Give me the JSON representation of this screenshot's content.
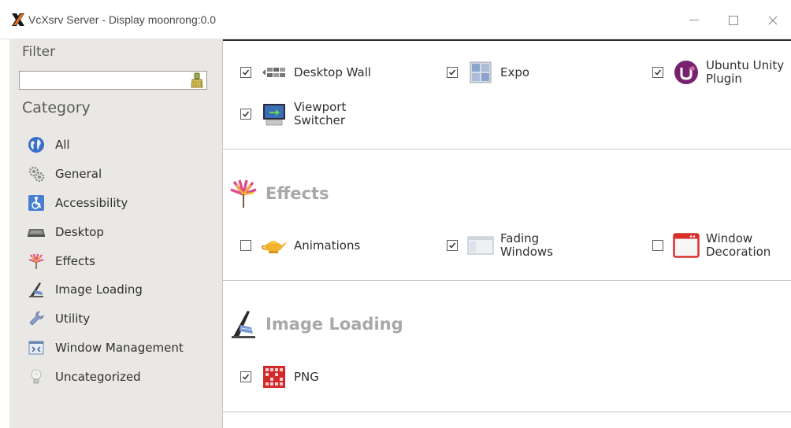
{
  "window": {
    "title": "VcXsrv Server - Display moonrong:0.0",
    "controls": {
      "minimize": "—",
      "maximize": "☐",
      "close": "✕"
    }
  },
  "sidebar": {
    "filter_title": "Filter",
    "filter_value": "",
    "category_title": "Category",
    "categories": [
      {
        "label": "All",
        "icon": "globe-icon"
      },
      {
        "label": "General",
        "icon": "gears-icon"
      },
      {
        "label": "Accessibility",
        "icon": "wheelchair-icon"
      },
      {
        "label": "Desktop",
        "icon": "desktop-icon"
      },
      {
        "label": "Effects",
        "icon": "firework-icon"
      },
      {
        "label": "Image Loading",
        "icon": "paintbrush-icon"
      },
      {
        "label": "Utility",
        "icon": "wrench-icon"
      },
      {
        "label": "Window Management",
        "icon": "window-management-icon"
      },
      {
        "label": "Uncategorized",
        "icon": "lightbulb-icon"
      }
    ]
  },
  "sections": {
    "desktop": {
      "plugins": [
        {
          "label": "Desktop Wall",
          "checked": true,
          "icon": "desktop-wall-icon"
        },
        {
          "label": "Expo",
          "checked": true,
          "icon": "expo-icon"
        },
        {
          "label": "Ubuntu Unity Plugin",
          "checked": true,
          "icon": "ubuntu-unity-icon"
        },
        {
          "label": "Viewport Switcher",
          "checked": true,
          "icon": "viewport-switcher-icon"
        }
      ]
    },
    "effects": {
      "title": "Effects",
      "plugins": [
        {
          "label": "Animations",
          "checked": false,
          "icon": "genie-lamp-icon"
        },
        {
          "label": "Fading Windows",
          "checked": true,
          "icon": "fading-windows-icon"
        },
        {
          "label": "Window Decoration",
          "checked": false,
          "icon": "window-decoration-icon"
        }
      ]
    },
    "image_loading": {
      "title": "Image Loading",
      "plugins": [
        {
          "label": "PNG",
          "checked": true,
          "icon": "png-icon"
        }
      ]
    }
  },
  "colors": {
    "sidebar_bg": "#eae8e4",
    "heading_gray": "#a8a8a8",
    "ubuntu_purple": "#77216f",
    "decoration_red": "#d9302b",
    "png_red": "#d22a2a"
  }
}
